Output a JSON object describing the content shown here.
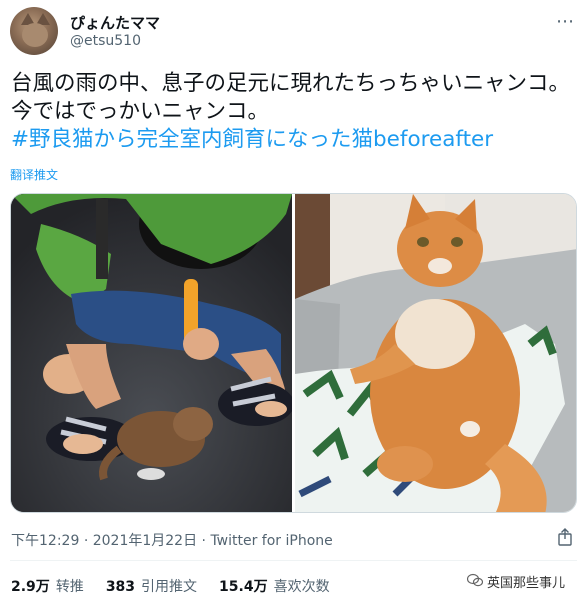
{
  "author": {
    "display_name": "ぴょんたママ",
    "handle": "@etsu510",
    "avatar_icon": "cat-avatar-icon"
  },
  "tweet": {
    "text": "台風の雨の中、息子の足元に現れたちっちゃいニャンコ。今ではでっかいニャンコ。",
    "hashtag": "#野良猫から完全室内飼育になった猫beforeafter",
    "translate_label": "翻译推文"
  },
  "media": {
    "images": [
      {
        "name": "kitten-before-photo"
      },
      {
        "name": "cat-after-photo"
      }
    ]
  },
  "meta": {
    "time": "下午12:29",
    "separator": "·",
    "date": "2021年1月22日",
    "source": "Twitter for iPhone"
  },
  "stats": {
    "retweets_value": "2.9万",
    "retweets_label": "转推",
    "quotes_value": "383",
    "quotes_label": "引用推文",
    "likes_value": "15.4万",
    "likes_label": "喜欢次数"
  },
  "watermark": {
    "text": "英国那些事儿"
  },
  "colors": {
    "accent": "#1d9bf0",
    "text": "#0f1419",
    "secondary": "#536471"
  }
}
